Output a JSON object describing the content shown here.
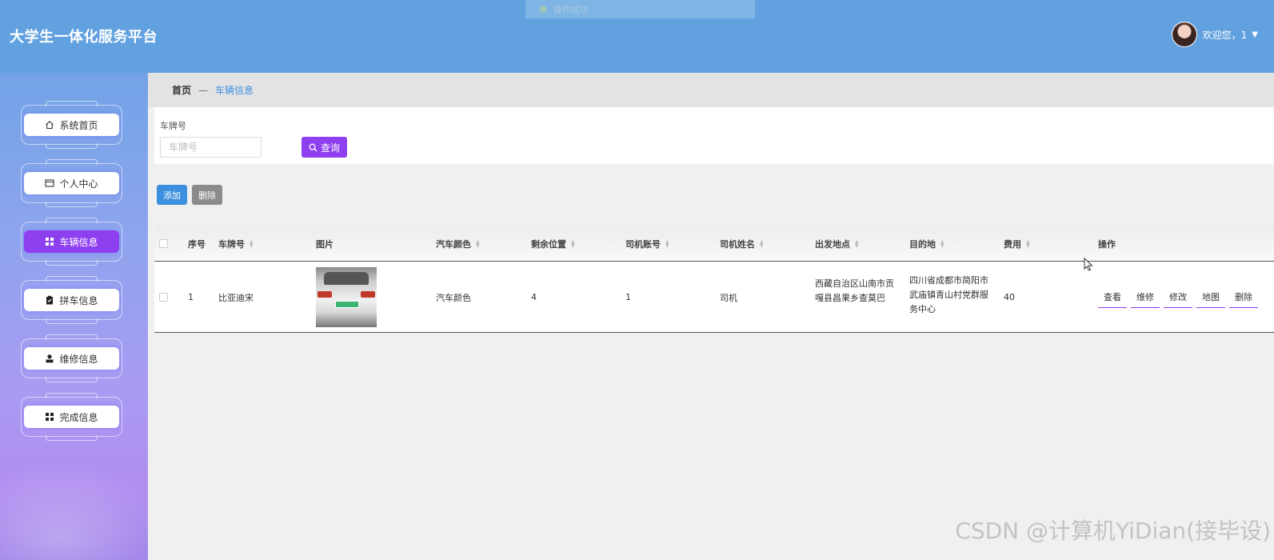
{
  "header": {
    "title": "大学生一体化服务平台",
    "welcome": "欢迎您，1",
    "toast": "操作成功"
  },
  "sidebar": {
    "items": [
      {
        "label": "系统首页",
        "icon": "home-icon",
        "active": false
      },
      {
        "label": "个人中心",
        "icon": "id-card-icon",
        "active": false
      },
      {
        "label": "车辆信息",
        "icon": "grid-icon",
        "active": true
      },
      {
        "label": "拼车信息",
        "icon": "clipboard-icon",
        "active": false
      },
      {
        "label": "维修信息",
        "icon": "user-icon",
        "active": false
      },
      {
        "label": "完成信息",
        "icon": "grid-icon",
        "active": false
      }
    ]
  },
  "breadcrumb": {
    "home": "首页",
    "separator": "—",
    "current": "车辆信息"
  },
  "search": {
    "label": "车牌号",
    "placeholder": "车牌号",
    "button": "查询"
  },
  "actions": {
    "add": "添加",
    "delete": "删除"
  },
  "table": {
    "columns": [
      "序号",
      "车牌号",
      "图片",
      "汽车颜色",
      "剩余位置",
      "司机账号",
      "司机姓名",
      "出发地点",
      "目的地",
      "费用",
      "操作"
    ],
    "rows": [
      {
        "index": "1",
        "plate": "比亚迪宋",
        "color": "汽车颜色",
        "seats": "4",
        "driver_account": "1",
        "driver_name": "司机",
        "origin": "西藏自治区山南市贡嘎县昌果乡查莫巴",
        "destination": "四川省成都市简阳市武庙镇青山村党群服务中心",
        "fee": "40",
        "ops": [
          "查看",
          "维修",
          "修改",
          "地图",
          "删除"
        ]
      }
    ]
  },
  "watermark": "CSDN @计算机YiDian(接毕设)",
  "colors": {
    "header": "#62a1e0",
    "accent": "#8e3ff0",
    "primary_button": "#3d8fe0",
    "breadcrumb_active": "#3b8fe0"
  }
}
